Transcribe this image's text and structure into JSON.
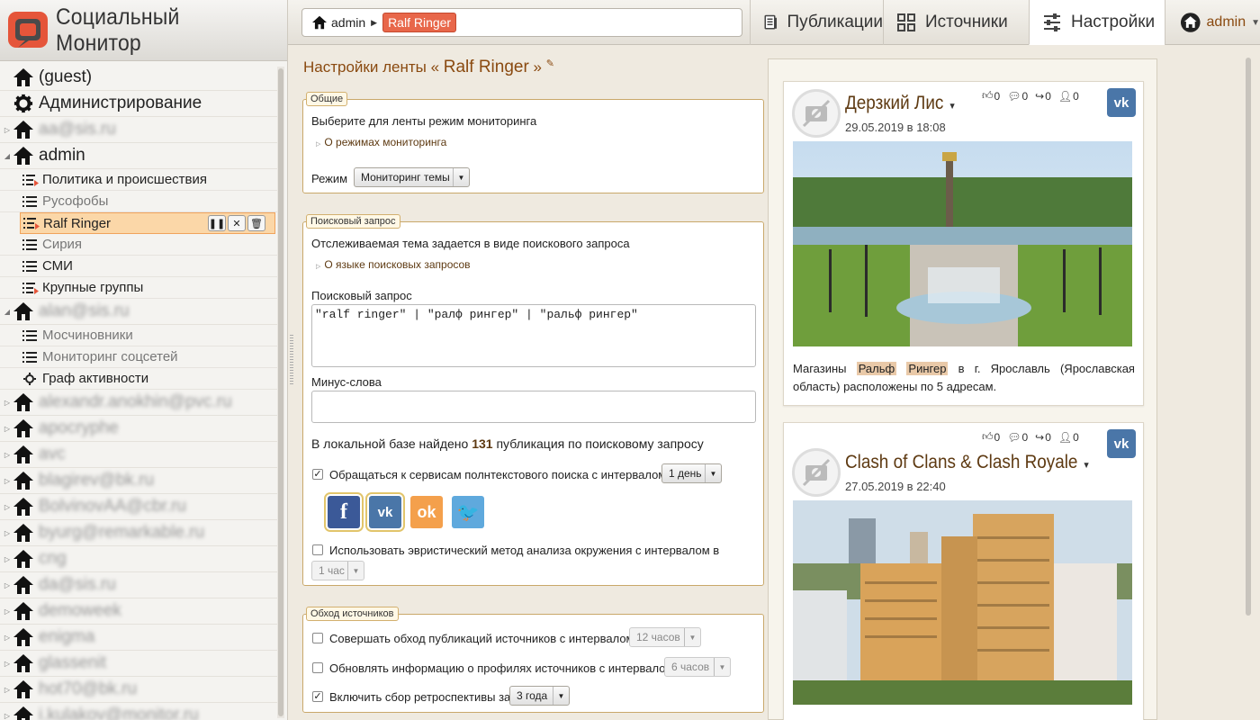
{
  "app": {
    "title": "Социальный Монитор"
  },
  "breadcrumb": {
    "user": "admin",
    "feed": "Ralf Ringer"
  },
  "nav": {
    "tabs": [
      {
        "label": "Публикации",
        "icon": "document-icon"
      },
      {
        "label": "Источники",
        "icon": "sources-icon"
      },
      {
        "label": "Настройки",
        "icon": "sliders-icon",
        "active": true
      }
    ],
    "user_label": "admin"
  },
  "tree": {
    "guest": "(guest)",
    "admin_section": "Администрирование",
    "user_aa": "aa@sis.ru",
    "admin": "admin",
    "admin_feeds": [
      "Политика и происшествия",
      "Русофобы",
      "Ralf Ringer",
      "Сирия",
      "СМИ",
      "Крупные группы"
    ],
    "user_alan": "alan@sis.ru",
    "alan_feeds": [
      "Мосчиновники",
      "Мониторинг соцсетей",
      "Граф активности"
    ],
    "other_users": [
      "alexandr.anokhin@pvc.ru",
      "apocryphe",
      "avc",
      "blagirev@bk.ru",
      "BolvinovAA@cbr.ru",
      "byurg@remarkable.ru",
      "cng",
      "da@sis.ru",
      "demoweek",
      "enigma",
      "glassenit",
      "hot70@bk.ru",
      "i.kulakov@monitor.ru"
    ]
  },
  "settings": {
    "title_prefix": "Настройки ленты «",
    "title_name": "Ralf Ringer",
    "title_suffix": "»",
    "general": {
      "legend": "Общие",
      "desc": "Выберите для ленты режим мониторинга",
      "hint": "О режимах мониторинга",
      "mode_label": "Режим",
      "mode_value": "Мониторинг темы"
    },
    "query": {
      "legend": "Поисковый запрос",
      "desc": "Отслеживаемая тема задается в виде поискового запроса",
      "hint": "О языке поисковых запросов",
      "query_label": "Поисковый запрос",
      "query_value": "\"ralf ringer\" | \"ралф рингер\" | \"ральф рингер\"",
      "minus_label": "Минус-слова",
      "minus_value": "",
      "found_prefix": "В локальной базе найдено",
      "found_count": "131",
      "found_suffix": "публикация по поисковому запросу",
      "fulltext_label": "Обращаться к сервисам полнтекстового поиска с интервалом в",
      "fulltext_interval": "1 день",
      "fulltext_checked": true,
      "networks": [
        "facebook",
        "vkontakte",
        "odnoklassniki",
        "twitter"
      ],
      "heuristic_label": "Использовать эвристический метод анализа окружения с интервалом в",
      "heuristic_interval": "1 час",
      "heuristic_checked": false
    },
    "crawl": {
      "legend": "Обход источников",
      "items": [
        {
          "label": "Совершать обход публикаций источников с интервалом в",
          "value": "12 часов",
          "checked": false
        },
        {
          "label": "Обновлять информацию о профилях источников с интервалом в",
          "value": "6 часов",
          "checked": false
        },
        {
          "label": "Включить сбор ретроспективы за:",
          "value": "3 года",
          "checked": true
        }
      ]
    }
  },
  "posts": [
    {
      "author": "Дерзкий Лис",
      "date": "29.05.2019 в 18:08",
      "likes": "0",
      "comments": "0",
      "reposts": "0",
      "views": "0",
      "network": "vk",
      "text_before": "Магазины",
      "hl1": "Ральф",
      "hl2": "Рингер",
      "text_after": "в г. Ярославль (Ярославская область) расположены по 5 адресам."
    },
    {
      "author": "Clash of Clans & Clash Royale",
      "date": "27.05.2019 в 22:40",
      "likes": "0",
      "comments": "0",
      "reposts": "0",
      "views": "0",
      "network": "vk"
    }
  ],
  "colors": {
    "accent": "#8a4a10",
    "active_feed": "#fbd7a8",
    "feed_tag": "#e8674a",
    "vk": "#4a76a8"
  }
}
